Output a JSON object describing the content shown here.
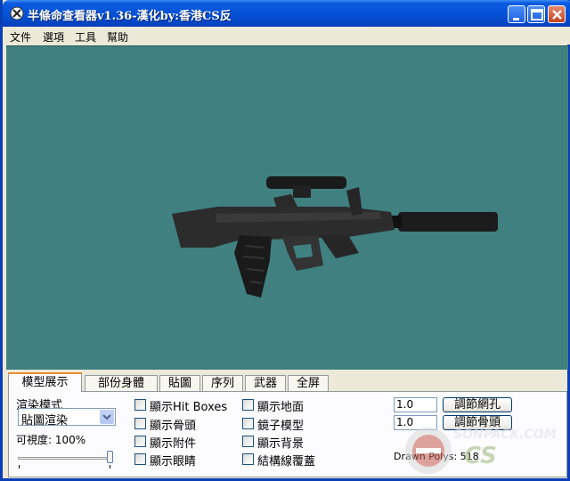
{
  "window": {
    "title": "半條命查看器v1.36-漢化by:香港CS反",
    "minimize_icon": "minimize-icon",
    "maximize_icon": "maximize-icon",
    "close_icon": "close-icon"
  },
  "menu": [
    "文件",
    "選項",
    "工具",
    "幫助"
  ],
  "viewport": {
    "background": "#408080",
    "model": "rifle-with-scope-and-silencer"
  },
  "tabs": [
    "模型展示",
    "部份身體",
    "貼圖",
    "序列",
    "武器",
    "全屏"
  ],
  "active_tab": "模型展示",
  "panel": {
    "render_mode_label": "渲染模式",
    "render_mode_value": "貼圖渲染",
    "visibility_label": "可視度: 100%",
    "visibility_value": 100,
    "checkboxes_col1": [
      "顯示Hit Boxes",
      "顯示骨頭",
      "顯示附件",
      "顯示眼睛"
    ],
    "checkboxes_col2": [
      "顯示地面",
      "鏡子模型",
      "顯示背景",
      "結構線覆蓋"
    ],
    "input1_value": "1.0",
    "input2_value": "1.0",
    "button1_label": "調節網孔",
    "button2_label": "調節骨頭",
    "drawn_polys": "Drawn Polys: 518"
  },
  "watermark_text": "SONPACK.COM"
}
